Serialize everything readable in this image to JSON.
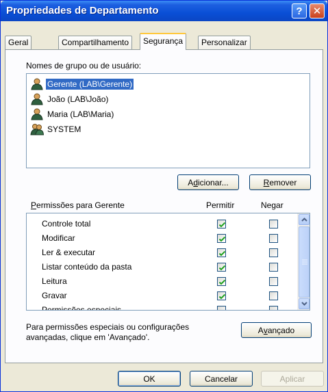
{
  "window": {
    "title": "Propriedades de Departamento",
    "help_glyph": "?",
    "close_glyph": "✕"
  },
  "tabs": [
    {
      "label": "Geral"
    },
    {
      "label": "Compartilhamento"
    },
    {
      "label": "Segurança",
      "active": true
    },
    {
      "label": "Personalizar"
    }
  ],
  "users": {
    "label_pre": "Nomes de ",
    "label_u": "g",
    "label_post": "rupo ou de usuário:",
    "items": [
      {
        "label": "Gerente (LAB\\Gerente)",
        "selected": true
      },
      {
        "label": "João (LAB\\João)"
      },
      {
        "label": "Maria (LAB\\Maria)"
      },
      {
        "label": "SYSTEM"
      }
    ]
  },
  "buttons": {
    "add_pre": "A",
    "add_u": "d",
    "add_post": "icionar...",
    "remove_u": "R",
    "remove_post": "emover",
    "advanced_pre": "A",
    "advanced_u": "v",
    "advanced_post": "ançado",
    "ok": "OK",
    "cancel": "Cancelar",
    "apply": "Aplicar"
  },
  "permissions": {
    "label_u": "P",
    "label_post": "ermissões para Gerente",
    "allow_header": "Permitir",
    "deny_header": "Negar",
    "rows": [
      {
        "name": "Controle total",
        "allow": true,
        "deny": false
      },
      {
        "name": "Modificar",
        "allow": true,
        "deny": false
      },
      {
        "name": "Ler & executar",
        "allow": true,
        "deny": false
      },
      {
        "name": "Listar conteúdo da pasta",
        "allow": true,
        "deny": false
      },
      {
        "name": "Leitura",
        "allow": true,
        "deny": false
      },
      {
        "name": "Gravar",
        "allow": true,
        "deny": false
      },
      {
        "name": "Permissões especiais",
        "allow": false,
        "deny": false
      }
    ]
  },
  "advanced_note": {
    "line1": "Para permissões especiais ou configurações",
    "line2": "avançadas, clique em 'Avançado'."
  },
  "colors": {
    "titlebar": "#0a4fd6",
    "selection": "#316ac5",
    "dialog_bg": "#ece9d8",
    "check": "#21a121"
  }
}
